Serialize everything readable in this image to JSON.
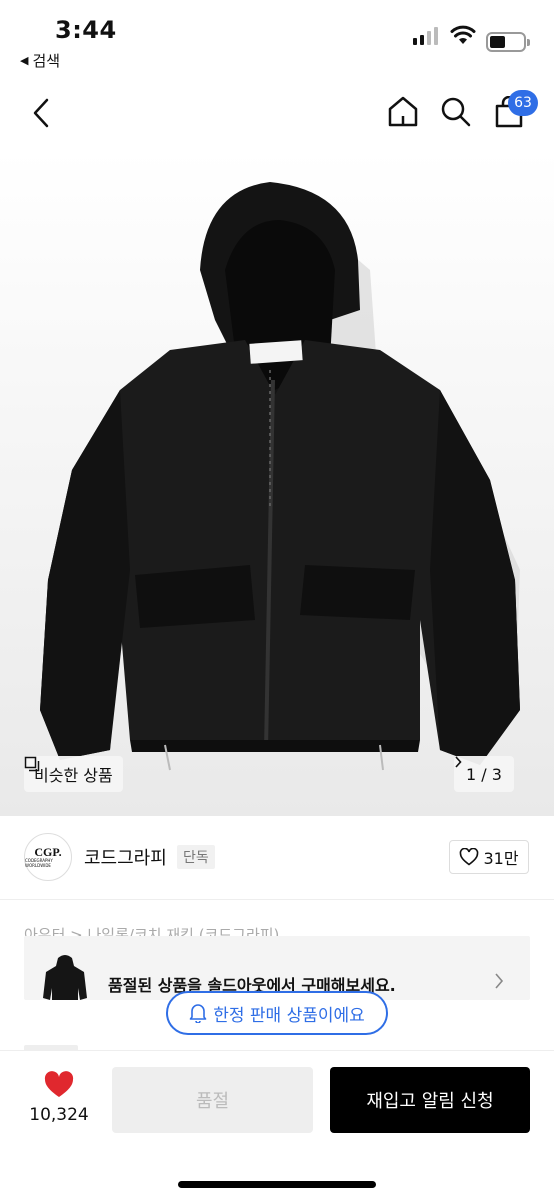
{
  "status_bar": {
    "time": "3:44",
    "back_app": "검색",
    "battery_percent": 40
  },
  "nav": {
    "cart_count": "63"
  },
  "product": {
    "similar_label": "비슷한 상품",
    "page_indicator": "1 / 3",
    "brand_logo_text": "CGP.",
    "brand_logo_sub": "CODEGRAPHY WORLDWIDE",
    "brand_name": "코드그라피",
    "brand_tag": "단독",
    "like_count": "31만",
    "breadcrumb": "아우터 > 나일론/코치 재킷 (코드그라피)"
  },
  "soldout_banner": {
    "text": "품절된 상품을 솔드아웃에서 구매해보세요."
  },
  "limited_pill": {
    "text": "한정 판매 상품이에요"
  },
  "bottom": {
    "wish_count": "10,324",
    "soldout_label": "품절",
    "restock_label": "재입고 알림 신청"
  },
  "colors": {
    "accent": "#2f6ee6",
    "heart": "#e0282e",
    "primary_button": "#000000"
  },
  "icons": [
    "back-chevron-icon",
    "home-icon",
    "search-icon",
    "cart-icon",
    "heart-icon",
    "bell-icon",
    "chevron-right-icon",
    "copy-icon"
  ]
}
